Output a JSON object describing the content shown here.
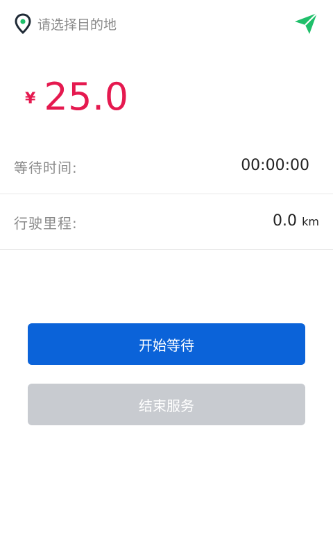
{
  "header": {
    "destination_placeholder": "请选择目的地",
    "pin_icon": "location-pin-icon",
    "send_icon": "paper-plane-icon"
  },
  "fare": {
    "currency": "¥",
    "amount": "25.0",
    "color": "#e5194f"
  },
  "info": {
    "wait_label": "等待时间:",
    "wait_value": "00:00:00",
    "distance_label": "行驶里程:",
    "distance_value": "0.0",
    "distance_unit": "km"
  },
  "actions": {
    "start_wait_label": "开始等待",
    "end_service_label": "结束服务",
    "start_color": "#0b63d9",
    "end_color_disabled": "#c8cbd0"
  },
  "accent_green": "#1fbf6a"
}
